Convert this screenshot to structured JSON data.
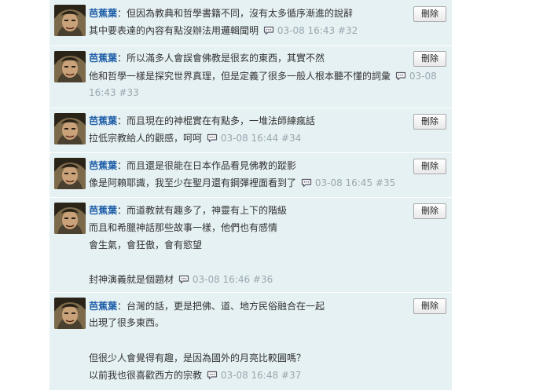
{
  "comments": [
    {
      "author": "芭蕉葉",
      "delete_label": "刪除",
      "lines": [
        "但因為教典和哲學書籍不同，沒有太多循序漸進的說辭",
        "其中要表達的內容有點沒辦法用邏輯聞明"
      ],
      "meta_line2_suffix": "03-08 16:43  #32"
    },
    {
      "author": "芭蕉葉",
      "delete_label": "刪除",
      "lines": [
        "所以滿多人會誤會佛教是很玄的東西，其實不然",
        "他和哲學一樣是探究世界真理，但是定義了很多一般人根本聽不懂的詞彙"
      ],
      "meta_a": "03-08",
      "meta_b": "16:43  #33"
    },
    {
      "author": "芭蕉葉",
      "delete_label": "刪除",
      "lines": [
        "而且現在的神棍實在有點多，一堆法師練瘋話",
        "拉低宗教給人的觀感，呵呵"
      ],
      "meta": "03-08 16:44  #34"
    },
    {
      "author": "芭蕉葉",
      "delete_label": "刪除",
      "lines": [
        "而且還是很能在日本作品看見佛教的蹤影",
        "像是阿賴耶識，我至少在聖月還有鋼彈裡面看到了"
      ],
      "meta": "03-08 16:45  #35"
    },
    {
      "author": "芭蕉葉",
      "delete_label": "刪除",
      "lines": [
        "而道教就有趣多了，神靈有上下的階級",
        "而且和希臘神話那些故事一樣，他們也有感情",
        "會生氣，會狂傲，會有慾望",
        "",
        "封神演義就是個題材"
      ],
      "meta": "03-08 16:46  #36"
    },
    {
      "author": "芭蕉葉",
      "delete_label": "刪除",
      "lines": [
        "台灣的話，更是把佛、道、地方民俗融合在一起",
        "出現了很多東西。",
        "",
        "但很少人會覺得有趣，是因為國外的月亮比較圓嗎？",
        "以前我也很喜歡西方的宗教"
      ],
      "meta": "03-08 16:48  #37"
    }
  ],
  "icons": {
    "avatar": "user-avatar-icon",
    "comment": "comment-bubble-icon"
  },
  "colors": {
    "background": "#e6f1f3",
    "author": "#1f5fa8",
    "meta": "#9aa7b0"
  }
}
